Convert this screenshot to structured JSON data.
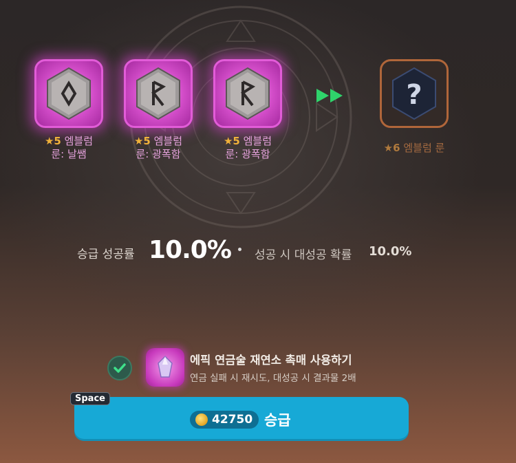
{
  "runes": [
    {
      "star": "★5",
      "name_line1": "엠블럼",
      "name_line2": "룬: 날쌤",
      "glyph": "diamond-rune"
    },
    {
      "star": "★5",
      "name_line1": "엠블럼",
      "name_line2": "룬: 광폭함",
      "glyph": "r-rune"
    },
    {
      "star": "★5",
      "name_line1": "엠블럼",
      "name_line2": "룬: 광폭함",
      "glyph": "r-rune"
    }
  ],
  "result": {
    "star": "★6",
    "name": "엠블럼 룬",
    "glyph": "question-mark"
  },
  "rates": {
    "success_label": "승급 성공률",
    "success_value": "10.0%",
    "crit_label": "성공 시 대성공 확률",
    "crit_value": "10.0%"
  },
  "catalyst": {
    "checked": true,
    "title": "에픽 연금술 재연소 촉매 사용하기",
    "description": "연금 실패 시 재시도, 대성공 시 결과물 2배"
  },
  "upgrade": {
    "hotkey": "Space",
    "cost": "42750",
    "label": "승급"
  },
  "colors": {
    "rune_glow": "#d24cc8",
    "button": "#17a9d6",
    "star": "#f0b23a",
    "arrow": "#2fd36b"
  }
}
